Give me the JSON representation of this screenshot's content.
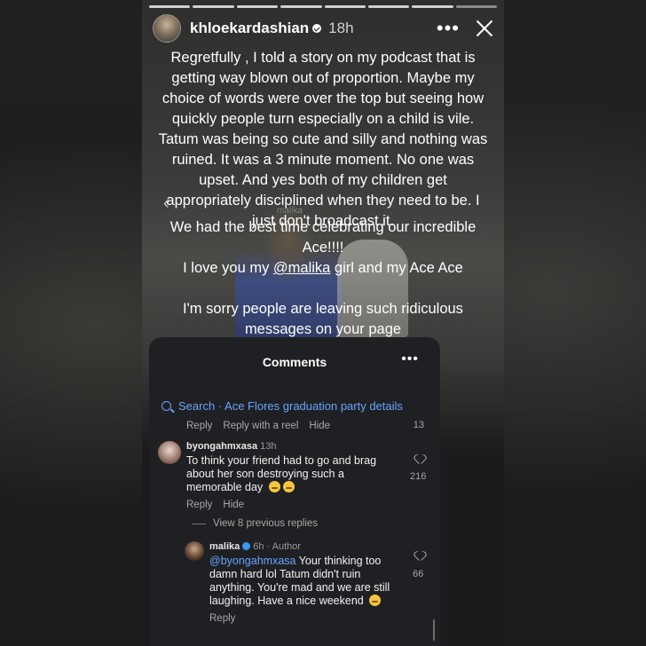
{
  "story": {
    "username": "khloekardashian",
    "time": "18h",
    "more_icon": "more-dots-icon",
    "close_icon": "close-icon",
    "progress_segments": 8,
    "ghost_label": "malika",
    "paragraphs": {
      "p1": "Regretfully , I told a story on my podcast that is getting way blown out of proportion. Maybe my choice of words were over the top but seeing how quickly people turn especially on a child is vile. Tatum was being so cute and silly and nothing was ruined. It was a 3 minute moment. No one was upset. And yes both of my children get appropriately disciplined when they need to be. I just don't broadcast it.",
      "p2": "We had the best time celebrating our incredible Ace!!!!",
      "p3_before": "I love you my ",
      "p3_mention": "@malika",
      "p3_after": " girl and my Ace Ace",
      "p4": "I'm sorry people are leaving such ridiculous messages on your page"
    }
  },
  "comments_panel": {
    "title": "Comments",
    "more_icon": "more-dots-icon",
    "search_text": "Search · Ace Flores graduation party details",
    "top_actions": {
      "reply": "Reply",
      "reply_reel": "Reply with a reel",
      "hide": "Hide",
      "count": "13"
    },
    "comment1": {
      "user": "byongahmxasa",
      "time": "13h",
      "body": "To think your friend had to go and brag about her son destroying such a memorable day",
      "likes": "216",
      "reply": "Reply",
      "hide": "Hide"
    },
    "view_replies": "View 8 previous replies",
    "reply1": {
      "user": "malika",
      "time": "6h",
      "author_tag": "· Author",
      "mention": "@byongahmxasa",
      "body": " Your thinking too damn hard lol Tatum didn't ruin anything. You're mad and we are still laughing. Have a nice weekend",
      "likes": "66",
      "reply": "Reply"
    }
  },
  "colors": {
    "link": "#6aa3ff",
    "panel_bg": "#1f2023",
    "verified": "#3b96f5"
  }
}
